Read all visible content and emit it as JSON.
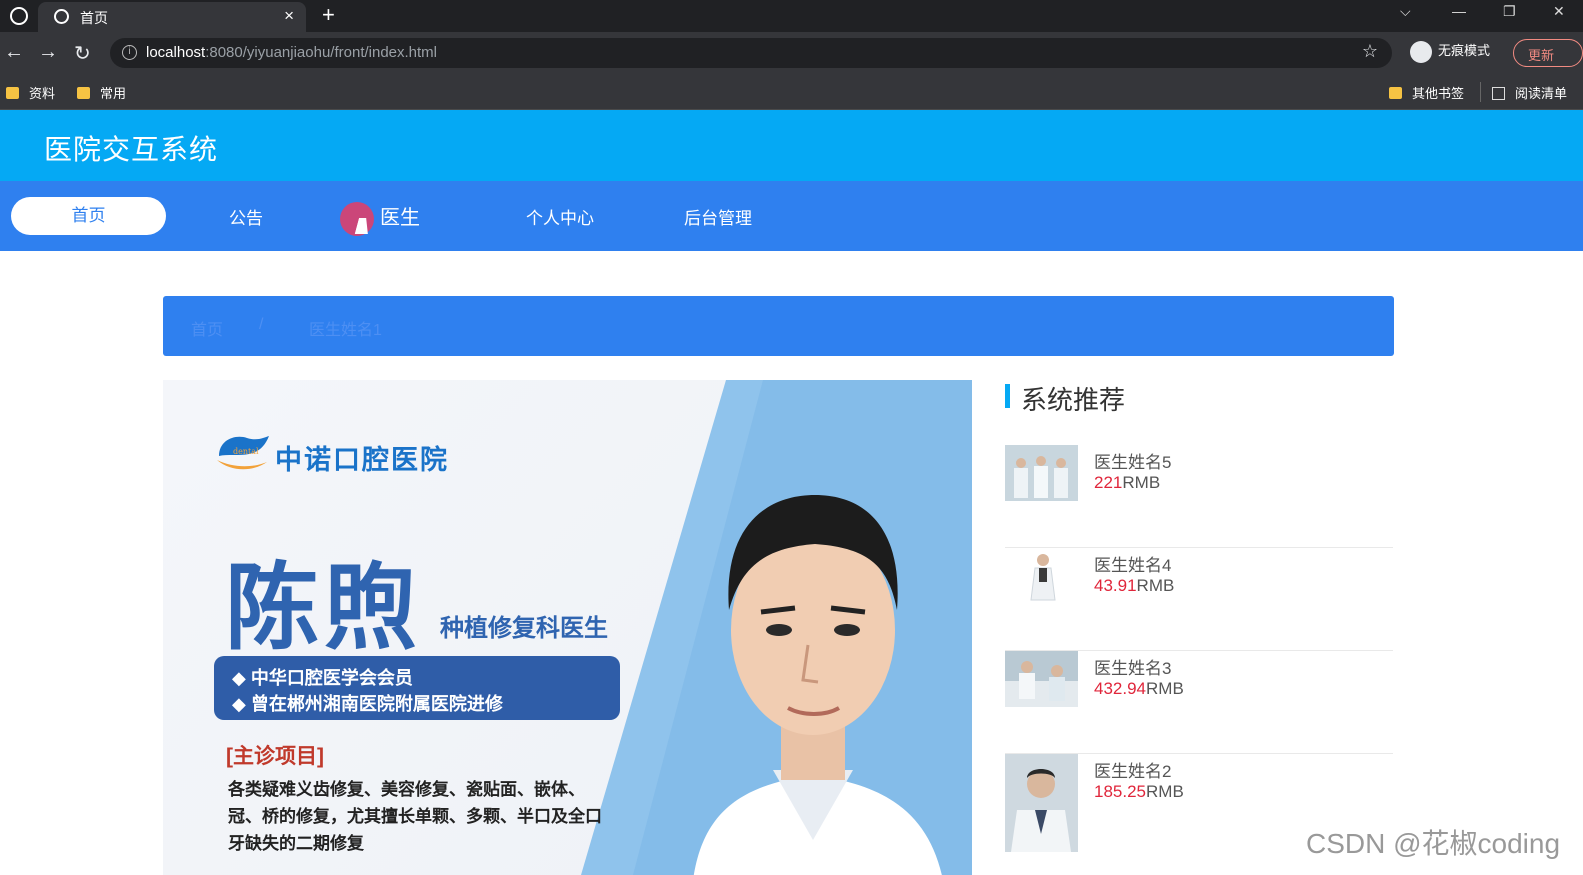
{
  "browser": {
    "tab_title": "首页",
    "tab_close": "×",
    "new_tab": "+",
    "win_controls": [
      "⌵",
      "—",
      "❐",
      "✕"
    ],
    "nav_back": "←",
    "nav_forward": "→",
    "nav_reload": "↻",
    "url_host": "localhost",
    "url_rest": ":8080/yiyuanjiaohu/front/index.html",
    "star": "☆",
    "incognito_label": "无痕模式",
    "update_label": "更新",
    "bookmarks": {
      "left": [
        "资料",
        "常用"
      ],
      "other": "其他书签",
      "reading": "阅读清单"
    }
  },
  "site": {
    "title": "医院交互系统",
    "nav": [
      "首页",
      "公告",
      "医生",
      "个人中心",
      "后台管理"
    ],
    "active_nav": "首页",
    "breadcrumb": [
      "首页",
      "医生姓名1"
    ],
    "breadcrumb_sep": "/"
  },
  "banner": {
    "hospital_name": "中诺口腔医院",
    "doctor_name": "陈煦",
    "doctor_dept": "种植修复科医生",
    "credentials": [
      "◆ 中华口腔医学会会员",
      "◆ 曾在郴州湘南医院附属医院进修"
    ],
    "main_title": "[主诊项目]",
    "main_desc": "各类疑难义齿修复、美容修复、瓷贴面、嵌体、冠、桥的修复，尤其擅长单颗、多颗、半口及全口牙缺失的二期修复"
  },
  "recommend": {
    "title": "系统推荐",
    "items": [
      {
        "name": "医生姓名5",
        "price": "221",
        "unit": "RMB"
      },
      {
        "name": "医生姓名4",
        "price": "43.91",
        "unit": "RMB"
      },
      {
        "name": "医生姓名3",
        "price": "432.94",
        "unit": "RMB"
      },
      {
        "name": "医生姓名2",
        "price": "185.25",
        "unit": "RMB"
      }
    ]
  },
  "watermark": "CSDN @花椒coding",
  "colors": {
    "header": "#05a9f4",
    "nav": "#2f80ef",
    "price": "#e0263b"
  }
}
